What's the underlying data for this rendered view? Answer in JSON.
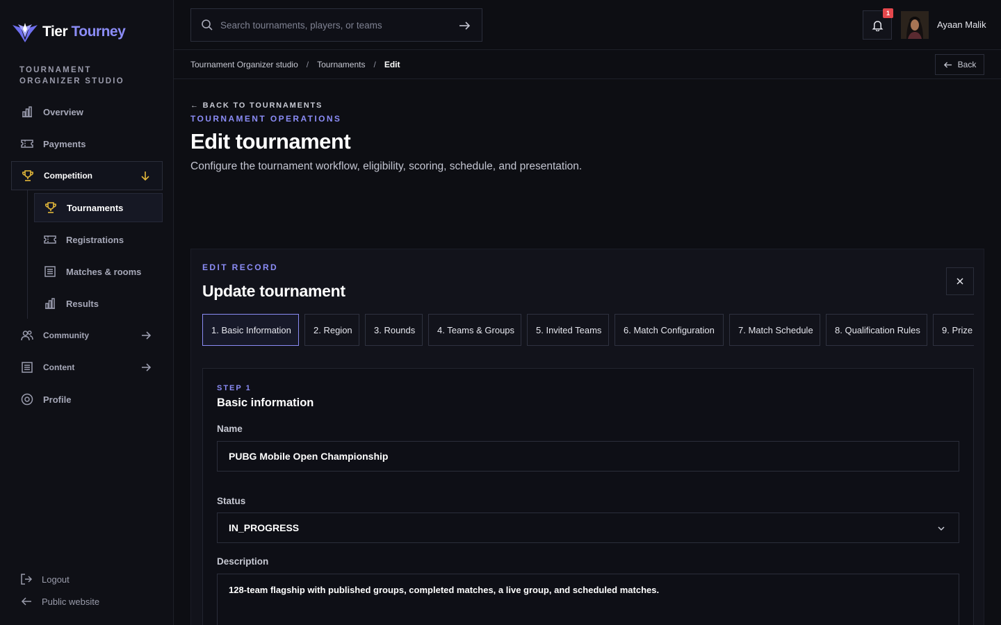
{
  "brand": {
    "name_part1": "Tier",
    "name_part2": "Tourney",
    "studio_label": "TOURNAMENT ORGANIZER STUDIO"
  },
  "sidebar": {
    "overview": "Overview",
    "payments": "Payments",
    "competition": "Competition",
    "tournaments": "Tournaments",
    "registrations": "Registrations",
    "matches": "Matches & rooms",
    "results": "Results",
    "community": "Community",
    "content": "Content",
    "profile": "Profile",
    "logout": "Logout",
    "public_website": "Public website"
  },
  "topbar": {
    "search_placeholder": "Search tournaments, players, or teams",
    "notification_count": "1",
    "user_name": "Ayaan Malik"
  },
  "breadcrumb": {
    "items": [
      "Tournament Organizer studio",
      "Tournaments",
      "Edit"
    ],
    "back_label": "Back"
  },
  "page": {
    "back_link": "← BACK TO TOURNAMENTS",
    "eyebrow": "TOURNAMENT OPERATIONS",
    "title": "Edit tournament",
    "subtitle": "Configure the tournament workflow, eligibility, scoring, schedule, and presentation."
  },
  "card": {
    "eyebrow": "EDIT RECORD",
    "title": "Update tournament",
    "tabs": [
      "1. Basic Information",
      "2. Region",
      "3. Rounds",
      "4. Teams & Groups",
      "5. Invited Teams",
      "6. Match Configuration",
      "7. Match Schedule",
      "8. Qualification Rules",
      "9. Prize"
    ]
  },
  "step": {
    "label": "STEP 1",
    "title": "Basic information",
    "name_label": "Name",
    "name_value": "PUBG Mobile Open Championship",
    "status_label": "Status",
    "status_value": "IN_PROGRESS",
    "description_label": "Description",
    "description_value": "128-team flagship with published groups, completed matches, a live group, and scheduled matches."
  },
  "colors": {
    "accent": "#8b8cf6",
    "gold": "#e5b93a",
    "badge": "#e5484d",
    "background": "#0d0e13"
  }
}
